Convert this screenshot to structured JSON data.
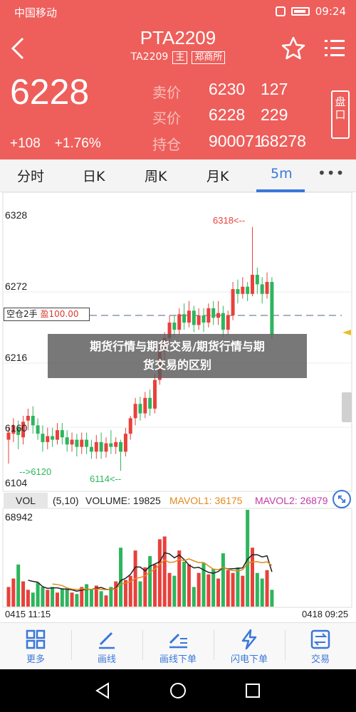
{
  "status_bar": {
    "carrier": "中国移动",
    "time": "09:24"
  },
  "header": {
    "title": "PTA2209",
    "subtitle": "TA2209",
    "tag_main": "主",
    "exchange": "郑商所",
    "price": "6228",
    "change_abs": "+108",
    "change_pct": "+1.76%",
    "sell_label": "卖价",
    "sell_price": "6230",
    "sell_vol": "127",
    "buy_label": "买价",
    "buy_price": "6228",
    "buy_vol": "229",
    "hold_label": "持仓",
    "hold_val": "900071",
    "hold_change": "68278",
    "pan_button": "盘口"
  },
  "tabs": {
    "items": [
      "分时",
      "日K",
      "周K",
      "月K",
      "5m"
    ],
    "active": "5m",
    "more": "•••"
  },
  "chart": {
    "price_labels": [
      "6328",
      "6272",
      "6216",
      "6160",
      "6104"
    ],
    "high_marker": "6318<--",
    "low_marker_left": "-->6120",
    "low_marker_right": "6114<--",
    "position_label": "空仓2手",
    "position_pl": "盈100.00"
  },
  "volume": {
    "button": "VOL",
    "params": "(5,10)",
    "volume": "VOLUME: 19825",
    "mavol1": "MAVOL1: 36175",
    "mavol2": "MAVOL2: 26879",
    "max": "68942",
    "time_start": "0415 11:15",
    "time_end": "0418 09:25"
  },
  "banner": {
    "line1": "期货行情与期货交易/期货行情与期",
    "line2": "货交易的区别"
  },
  "toolbar": {
    "items": [
      "更多",
      "画线",
      "画线下单",
      "闪电下单",
      "交易"
    ]
  },
  "colors": {
    "header_bg": "#ee5f5b",
    "up": "#e8413c",
    "down": "#2db55d",
    "accent": "#3a77d9"
  },
  "chart_data": {
    "type": "candlestick",
    "title": "",
    "interval": "5m",
    "ylim": [
      6104,
      6328
    ],
    "yticks": [
      6104,
      6160,
      6216,
      6272,
      6328
    ],
    "position_line": 6244,
    "candles": [
      [
        6140,
        6146,
        6120,
        6150
      ],
      [
        6145,
        6152,
        6138,
        6158
      ],
      [
        6150,
        6144,
        6132,
        6156
      ],
      [
        6142,
        6155,
        6136,
        6160
      ],
      [
        6156,
        6160,
        6148,
        6166
      ],
      [
        6160,
        6152,
        6145,
        6168
      ],
      [
        6152,
        6145,
        6140,
        6158
      ],
      [
        6145,
        6138,
        6130,
        6152
      ],
      [
        6138,
        6143,
        6132,
        6150
      ],
      [
        6143,
        6140,
        6134,
        6150
      ],
      [
        6140,
        6148,
        6136,
        6154
      ],
      [
        6148,
        6142,
        6136,
        6154
      ],
      [
        6142,
        6136,
        6130,
        6148
      ],
      [
        6136,
        6140,
        6130,
        6146
      ],
      [
        6140,
        6134,
        6126,
        6145
      ],
      [
        6134,
        6140,
        6128,
        6146
      ],
      [
        6140,
        6134,
        6128,
        6146
      ],
      [
        6134,
        6130,
        6124,
        6140
      ],
      [
        6130,
        6138,
        6124,
        6144
      ],
      [
        6138,
        6130,
        6124,
        6146
      ],
      [
        6130,
        6137,
        6125,
        6142
      ],
      [
        6137,
        6134,
        6128,
        6148
      ],
      [
        6134,
        6138,
        6128,
        6142
      ],
      [
        6138,
        6130,
        6114,
        6140
      ],
      [
        6130,
        6145,
        6126,
        6150
      ],
      [
        6145,
        6158,
        6140,
        6160
      ],
      [
        6158,
        6170,
        6152,
        6175
      ],
      [
        6170,
        6162,
        6156,
        6176
      ],
      [
        6162,
        6175,
        6158,
        6180
      ],
      [
        6175,
        6166,
        6160,
        6182
      ],
      [
        6166,
        6190,
        6162,
        6195
      ],
      [
        6190,
        6215,
        6186,
        6220
      ],
      [
        6215,
        6225,
        6206,
        6230
      ],
      [
        6225,
        6238,
        6220,
        6244
      ],
      [
        6238,
        6232,
        6226,
        6244
      ],
      [
        6232,
        6245,
        6228,
        6250
      ],
      [
        6245,
        6238,
        6232,
        6254
      ],
      [
        6238,
        6248,
        6234,
        6256
      ],
      [
        6248,
        6236,
        6230,
        6252
      ],
      [
        6236,
        6244,
        6232,
        6250
      ],
      [
        6244,
        6238,
        6230,
        6250
      ],
      [
        6238,
        6250,
        6234,
        6254
      ],
      [
        6250,
        6242,
        6236,
        6256
      ],
      [
        6242,
        6246,
        6236,
        6256
      ],
      [
        6246,
        6232,
        6226,
        6252
      ],
      [
        6232,
        6244,
        6228,
        6248
      ],
      [
        6244,
        6266,
        6240,
        6272
      ],
      [
        6266,
        6262,
        6254,
        6274
      ],
      [
        6262,
        6268,
        6258,
        6276
      ],
      [
        6268,
        6262,
        6256,
        6272
      ],
      [
        6262,
        6278,
        6260,
        6318
      ],
      [
        6278,
        6270,
        6262,
        6284
      ],
      [
        6270,
        6262,
        6254,
        6276
      ],
      [
        6262,
        6272,
        6258,
        6280
      ],
      [
        6272,
        6228,
        6224,
        6276
      ]
    ],
    "volumes": [
      14,
      20,
      30,
      18,
      12,
      10,
      17,
      14,
      12,
      14,
      10,
      13,
      13,
      10,
      9,
      14,
      16,
      12,
      15,
      11,
      8,
      14,
      18,
      42,
      19,
      22,
      40,
      18,
      28,
      36,
      30,
      48,
      50,
      24,
      22,
      40,
      32,
      30,
      14,
      24,
      31,
      23,
      27,
      20,
      38,
      26,
      24,
      28,
      22,
      69,
      42,
      24,
      20,
      26,
      12
    ],
    "vol_ylim": [
      0,
      68942
    ]
  }
}
